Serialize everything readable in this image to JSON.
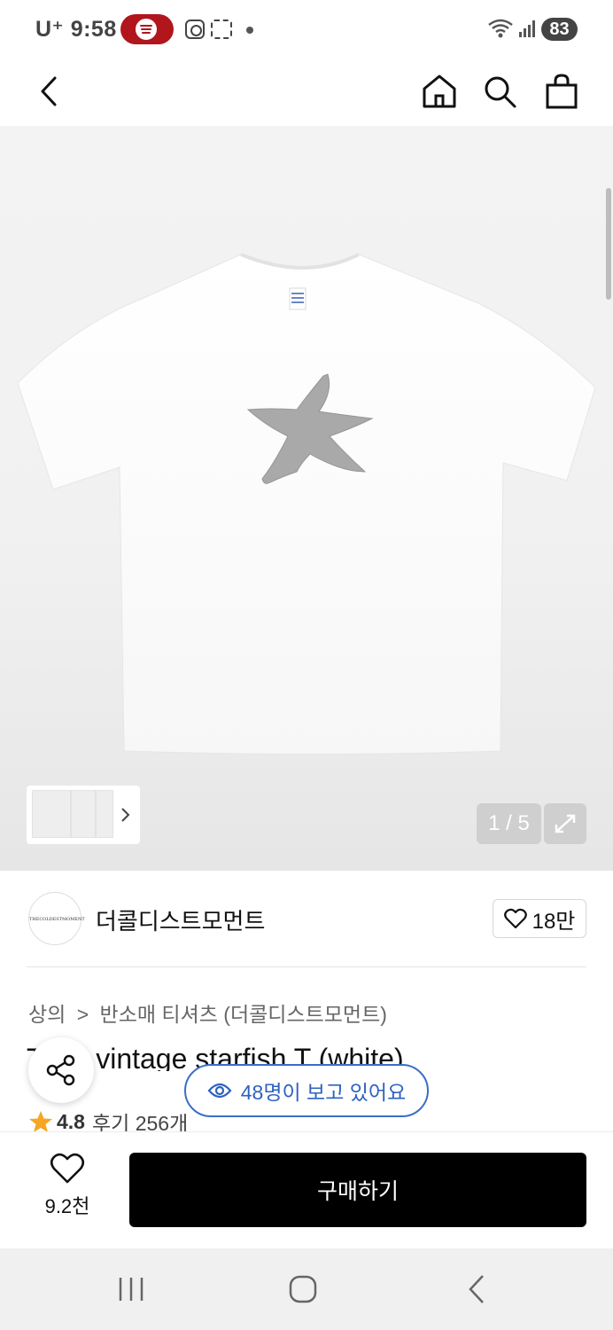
{
  "status_bar": {
    "carrier": "U⁺",
    "time": "9:58",
    "battery": "83"
  },
  "header": {
    "back_icon": "chevron-left-icon",
    "home_icon": "home-icon",
    "search_icon": "search-icon",
    "bag_icon": "shopping-bag-icon"
  },
  "gallery": {
    "counter": "1 / 5",
    "thumbnail_count": 3,
    "expand_icon": "expand-icon"
  },
  "brand": {
    "name": "더콜디스트모먼트",
    "logo_text": "THECOLDESTMOMENT",
    "likes": "18만"
  },
  "product": {
    "breadcrumb_category": "상의",
    "breadcrumb_separator": ">",
    "breadcrumb_sub": "반소매 티셔츠 (더콜디스트모먼트)",
    "title": "TCM vintage starfish T (white)",
    "rating": "4.8",
    "reviews": "후기 256개"
  },
  "viewers_badge": {
    "text": "48명이 보고 있어요"
  },
  "action_bar": {
    "wishlist_count": "9.2천",
    "buy_label": "구매하기"
  },
  "colors": {
    "spotify_badge": "#b0161c",
    "viewers_accent": "#2f62c0",
    "buy_button": "#000000",
    "star": "#f5a623"
  }
}
